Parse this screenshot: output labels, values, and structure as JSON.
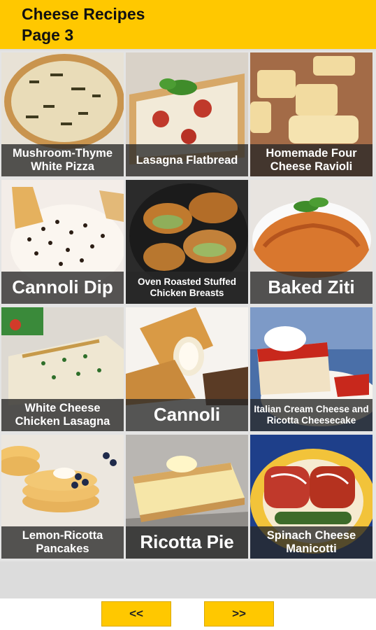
{
  "header": {
    "title_line1": "Cheese Recipes",
    "title_line2": "Page 3"
  },
  "recipes": [
    {
      "title": "Mushroom-Thyme White Pizza"
    },
    {
      "title": "Lasagna Flatbread"
    },
    {
      "title": "Homemade Four Cheese Ravioli"
    },
    {
      "title": "Cannoli Dip"
    },
    {
      "title": "Oven Roasted Stuffed Chicken Breasts"
    },
    {
      "title": "Baked Ziti"
    },
    {
      "title": "White Cheese Chicken Lasagna"
    },
    {
      "title": "Cannoli"
    },
    {
      "title": "Italian Cream Cheese and Ricotta Cheesecake"
    },
    {
      "title": "Lemon-Ricotta Pancakes"
    },
    {
      "title": "Ricotta Pie"
    },
    {
      "title": "Spinach Cheese Manicotti"
    }
  ],
  "nav": {
    "prev_label": "<<",
    "next_label": ">>"
  },
  "colors": {
    "accent": "#ffc800",
    "caption_bg": "#2a2a2a"
  }
}
